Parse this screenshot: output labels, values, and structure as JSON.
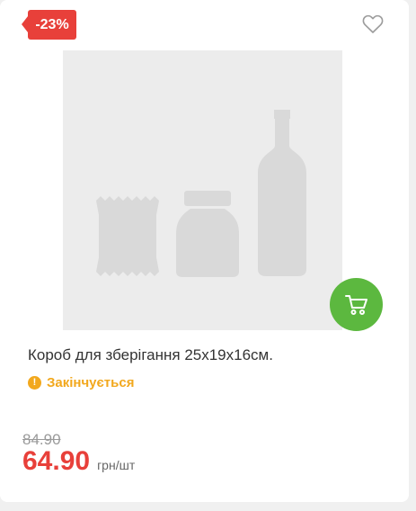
{
  "product": {
    "discount_badge": "-23%",
    "title": "Короб для зберігання 25х19х16см.",
    "stock_icon_glyph": "!",
    "stock_status": "Закінчується",
    "old_price": "84.90",
    "price": "64.90",
    "unit": "грн/шт"
  },
  "icons": {
    "favorite": "heart-outline-icon",
    "cart": "shopping-cart-icon",
    "stock": "exclamation-circle-icon",
    "placeholder": "product-placeholder-image"
  },
  "colors": {
    "accent_red": "#e8403a",
    "cart_green": "#5cb83f",
    "warning_orange": "#f2a81d",
    "placeholder_bg": "#ececec",
    "placeholder_shape": "#d9d9d9"
  }
}
